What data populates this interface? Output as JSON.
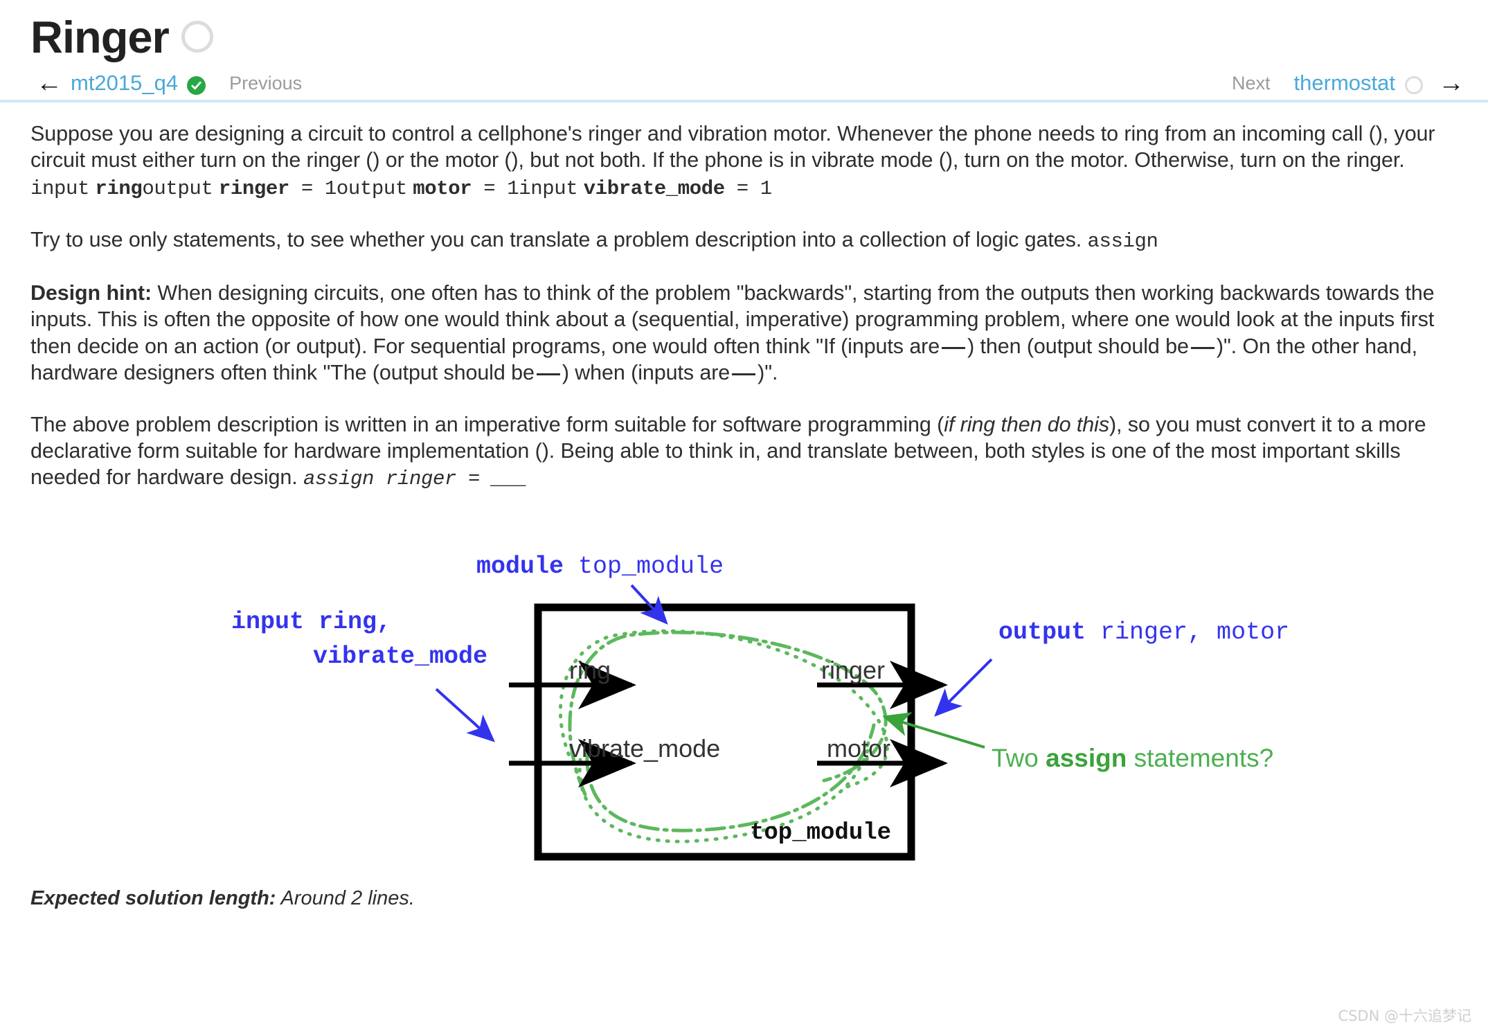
{
  "header": {
    "title": "Ringer",
    "status_icon": "empty-circle-icon"
  },
  "nav": {
    "prev_arrow": "←",
    "prev_link": "mt2015_q4",
    "prev_status_icon": "green-check-icon",
    "prev_label": "Previous",
    "next_label": "Next",
    "next_link": "thermostat",
    "next_status_icon": "empty-circle-icon",
    "next_arrow": "→"
  },
  "content": {
    "p1_a": "Suppose you are designing a circuit to control a cellphone's ringer and vibration motor. Whenever the phone needs to ring from an incoming call (), your circuit must either turn on the ringer () or the motor (), but not both. If the phone is in vibrate mode (), turn on the motor. Otherwise, turn on the ringer.",
    "p1_code_1": "input",
    "p1_code_2": "ring",
    "p1_code_3": "output",
    "p1_code_4": "ringer",
    "p1_code_5": " = 1",
    "p1_code_6": "output",
    "p1_code_7": "motor",
    "p1_code_8": " = 1",
    "p1_code_9": "input",
    "p1_code_10": "vibrate_mode",
    "p1_code_11": " = 1",
    "p2_text": "Try to use only statements, to see whether you can translate a problem description into a collection of logic gates.",
    "p2_code": "assign",
    "p3_lead": "Design hint:",
    "p3_a": " When designing circuits, one often has to think of the problem \"backwards\", starting from the outputs then working backwards towards the inputs. This is often the opposite of how one would think about a (sequential, imperative) programming problem, where one would look at the inputs first then decide on an action (or output). For sequential programs, one would often think \"If (inputs are",
    "p3_b": ") then (output should be",
    "p3_c": ")\". On the other hand, hardware designers often think \"The (output should be",
    "p3_d": ") when (inputs are",
    "p3_e": ")\".",
    "p4_a": "The above problem description is written in an imperative form suitable for software programming (",
    "p4_italic": "if ring then do this",
    "p4_b": "), so you must convert it to a more declarative form suitable for hardware implementation (). Being able to think in, and translate between, both styles is one of the most important skills needed for hardware design.",
    "p4_code": "assign ringer = ___"
  },
  "diagram": {
    "annotation_module": "module top_module",
    "annotation_module_kw": "module",
    "annotation_module_name": " top_module",
    "annotation_input_kw": "input ring,",
    "annotation_input_line2": "vibrate_mode",
    "annotation_output_kw": "output",
    "annotation_output_names": " ringer, motor",
    "annotation_assign_pre": "Two ",
    "annotation_assign_kw": "assign",
    "annotation_assign_post": " statements?",
    "port_ring": "ring",
    "port_vibrate_mode": "vibrate_mode",
    "port_ringer": "ringer",
    "port_motor": "motor",
    "box_label": "top_module",
    "colors": {
      "annotation_blue": "#3333ee",
      "annotation_green": "#3aa33a",
      "wire_green": "#5cb85c",
      "box_black": "#000000"
    }
  },
  "footer": {
    "expected_label": "Expected solution length:",
    "expected_value": " Around 2 lines.",
    "watermark": "CSDN @十六追梦记"
  }
}
